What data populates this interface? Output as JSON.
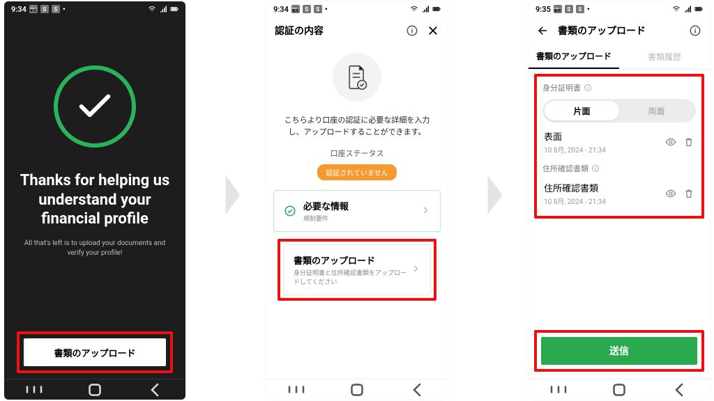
{
  "screen1": {
    "status_time": "9:34",
    "status_indicator": "S",
    "title": "Thanks for helping us understand your financial profile",
    "subtitle": "All that's left is to upload your documents and verify your profile!",
    "button_label": "書類のアップロード"
  },
  "screen2": {
    "status_time": "9:34",
    "status_indicator": "S",
    "header_title": "認証の内容",
    "description": "こちらより口座の認証に必要な詳細を入力し、アップロードすることができます。",
    "status_label": "口座ステータス",
    "status_value": "認証されていません",
    "card_required": {
      "title": "必要な情報",
      "subtitle": "規制要件"
    },
    "card_upload": {
      "title": "書類のアップロード",
      "subtitle": "身分証明書と住所確認書類をアップロードしてください"
    }
  },
  "screen3": {
    "status_time": "9:35",
    "status_indicator": "S",
    "header_title": "書類のアップロード",
    "tabs": {
      "upload": "書類のアップロード",
      "history": "書類履歴"
    },
    "section_id": "身分証明書",
    "segment": {
      "single": "片面",
      "double": "両面"
    },
    "item1": {
      "name": "表面",
      "timestamp": "10 8月, 2024 - 21:34"
    },
    "section_addr": "住所確認書類",
    "item2": {
      "name": "住所確認書類",
      "timestamp": "10 8月, 2024 - 21:34"
    },
    "send_label": "送信"
  }
}
